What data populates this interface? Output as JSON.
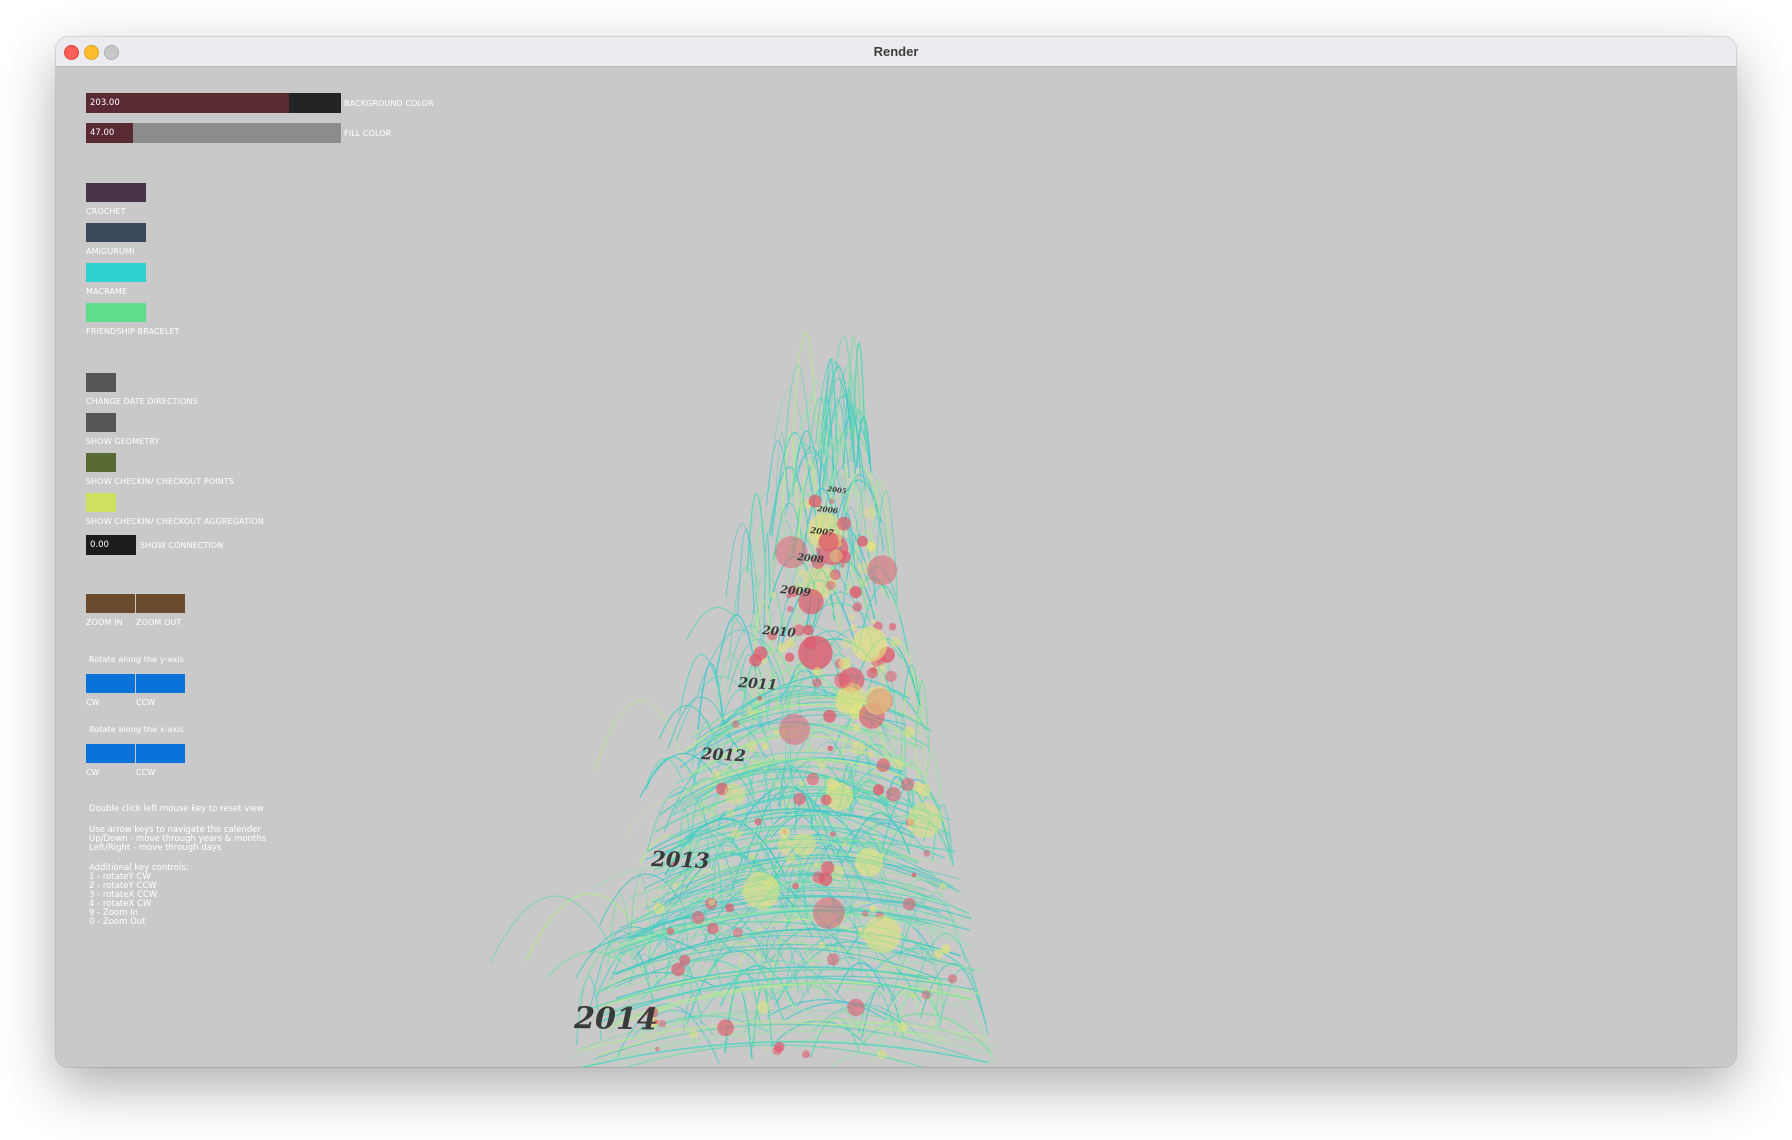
{
  "window": {
    "title": "Render"
  },
  "sliders": {
    "background": {
      "label": "BACKGROUND COLOR",
      "value": "203.00",
      "fraction": 0.796
    },
    "fill": {
      "label": "FILL COLOR",
      "value": "47.00",
      "fraction": 0.184
    },
    "connection": {
      "label": "SHOW CONNECTION",
      "value": "0.00"
    }
  },
  "categories": [
    {
      "label": "CROCHET",
      "color": "#4a3449"
    },
    {
      "label": "AMIGURUMI",
      "color": "#3a4a5c"
    },
    {
      "label": "MACRAME",
      "color": "#2fd0cf"
    },
    {
      "label": "FRIENDSHIP BRACELET",
      "color": "#5fdd8a"
    }
  ],
  "toggles": [
    {
      "label": "CHANGE DATE DIRECTIONS",
      "color": "#565656"
    },
    {
      "label": "SHOW GEOMETRY",
      "color": "#565656"
    },
    {
      "label": "SHOW CHECKIN/ CHECKOUT POINTS",
      "color": "#5a6a33"
    },
    {
      "label": "SHOW CHECKIN/ CHECKOUT AGGREGATION",
      "color": "#cfe060"
    }
  ],
  "zoom": {
    "in_label": "ZOOM IN",
    "out_label": "ZOOM OUT",
    "color": "#6b4a2e"
  },
  "rotate_y": {
    "title": "Rotate along the y-axis",
    "cw": "CW",
    "ccw": "CCW",
    "color": "#0a72d8"
  },
  "rotate_x": {
    "title": "Rotate along the x-axis",
    "cw": "CW",
    "ccw": "CCW",
    "color": "#0a72d8"
  },
  "help": {
    "reset": "Double click left mouse key to reset view",
    "arrows": "Use arrow keys to navigate the calender\nUp/Down - move through years & months\nLeft/Right - move through days",
    "keys": "Additional key controls:\n1 - rotateY CW\n2 - rotateY CCW\n3 - rotateX CCW\n4 - rotateX CW\n9 - Zoom In\n0 - Zoom Out"
  },
  "years": [
    "2005",
    "2006",
    "2007",
    "2008",
    "2009",
    "2010",
    "2011",
    "2012",
    "2013",
    "2014"
  ],
  "colors": {
    "background": "#c9c9c9",
    "slider_fill": "#5a2a32",
    "slider_track_dark": "#232323",
    "slider_track_gray": "#8c8c8c",
    "connection": "#1c1c1c"
  }
}
